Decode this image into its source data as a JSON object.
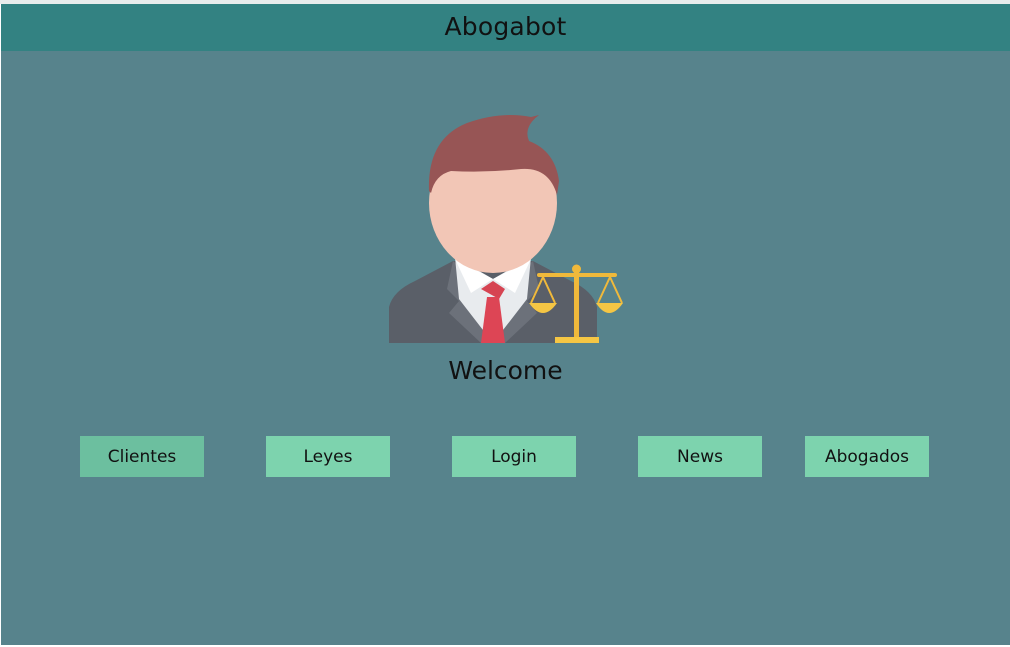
{
  "app": {
    "title": "Abogabot"
  },
  "main": {
    "avatar_icon": "lawyer-with-scales-icon",
    "welcome_text": "Welcome"
  },
  "nav": {
    "buttons": [
      {
        "label": "Clientes",
        "active": true
      },
      {
        "label": "Leyes"
      },
      {
        "label": "Login"
      },
      {
        "label": "News"
      },
      {
        "label": "Abogados"
      }
    ]
  },
  "colors": {
    "background": "#57838c",
    "header": "#338282",
    "button": "#7dd3ae",
    "button_active": "#6cbf9f"
  }
}
